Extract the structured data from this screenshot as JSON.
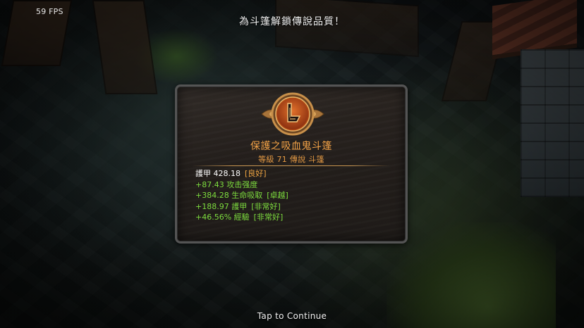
{
  "hud": {
    "fps": "59 FPS"
  },
  "notice": "為斗篷解鎖傳說品質！",
  "item": {
    "icon": "cape-emblem-icon",
    "name": "保護之吸血鬼斗篷",
    "level_line": "等級 71 傳說 斗篷",
    "stats": [
      {
        "text": "護甲 428.18",
        "quality": "[良好]"
      },
      {
        "text": "+87.43 攻击强度",
        "quality": ""
      },
      {
        "text": "+384.28 生命吸取",
        "quality": "[卓越]"
      },
      {
        "text": "+188.97 護甲",
        "quality": "[非常好]"
      },
      {
        "text": "+46.56% 經驗",
        "quality": "[非常好]"
      }
    ]
  },
  "colors": {
    "legendary_orange": "#f2a246",
    "bonus_green": "#7ddc3e",
    "card_border": "#545454"
  },
  "footer": {
    "prompt": "Tap to Continue"
  }
}
